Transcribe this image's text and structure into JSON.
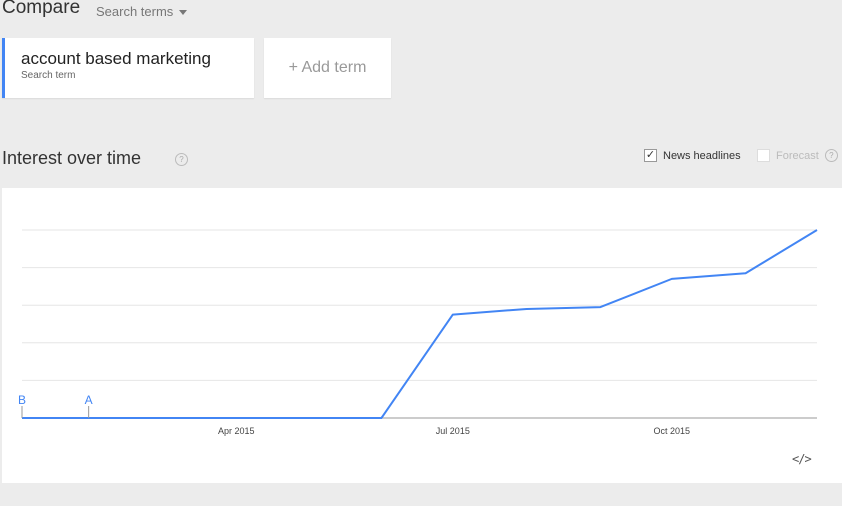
{
  "compare": {
    "title": "Compare",
    "search_terms_label": "Search terms"
  },
  "term": {
    "name": "account based marketing",
    "sublabel": "Search term",
    "color": "#4285f4"
  },
  "add_term": {
    "label": "+ Add term"
  },
  "section": {
    "title": "Interest over time",
    "help": "?"
  },
  "options": {
    "news_headlines": {
      "label": "News headlines",
      "checked": true
    },
    "forecast": {
      "label": "Forecast",
      "checked": false,
      "help": "?"
    }
  },
  "chart_data": {
    "type": "line",
    "xlabel": "",
    "ylabel": "",
    "ylim": [
      0,
      100
    ],
    "grid": true,
    "x": [
      "2015-01-01",
      "2015-02-01",
      "2015-03-01",
      "2015-04-01",
      "2015-05-01",
      "2015-06-01",
      "2015-07-01",
      "2015-08-01",
      "2015-09-01",
      "2015-10-01",
      "2015-11-01",
      "2015-12-01"
    ],
    "x_tick_labels": [
      "Apr 2015",
      "Jul 2015",
      "Oct 2015"
    ],
    "series": [
      {
        "color": "#4285f4",
        "values": [
          0,
          0,
          0,
          0,
          0,
          0,
          55,
          58,
          59,
          74,
          77,
          100
        ]
      }
    ],
    "annotations": [
      {
        "label": "B",
        "x": "2015-01-01"
      },
      {
        "label": "A",
        "x": "2015-01-29"
      }
    ]
  },
  "embed": {
    "label": "</>"
  }
}
